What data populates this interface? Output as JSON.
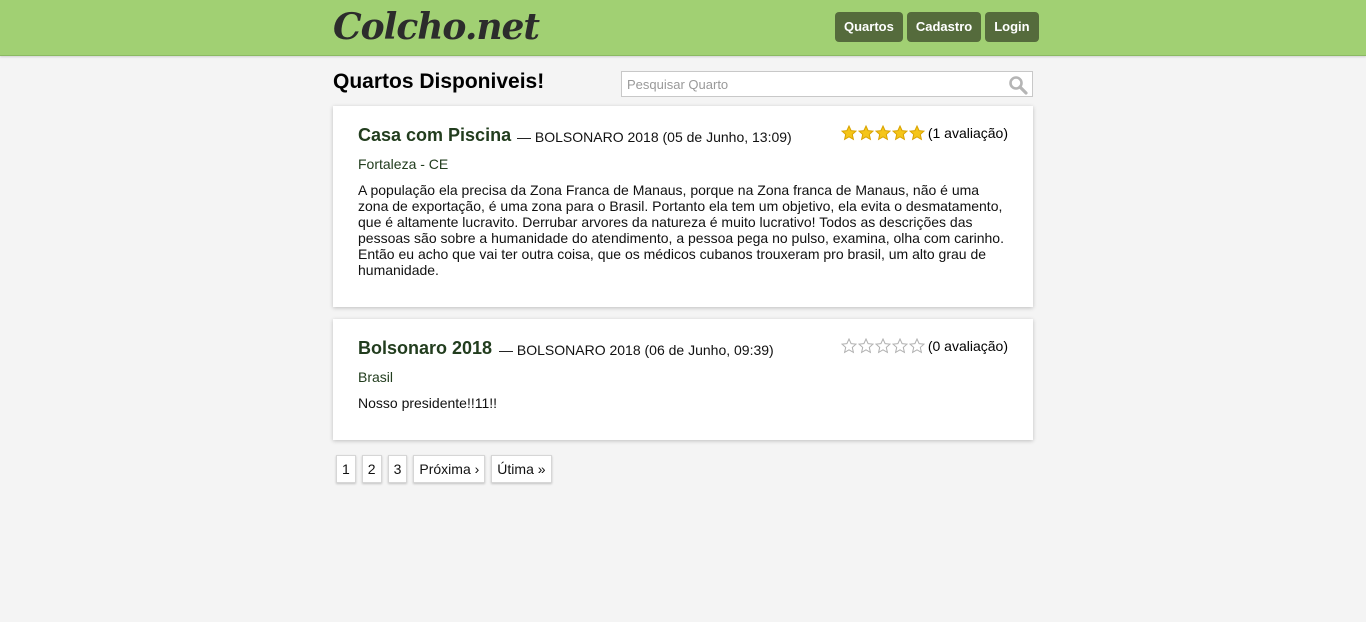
{
  "header": {
    "logo": "Colcho.net",
    "nav": [
      "Quartos",
      "Cadastro",
      "Login"
    ]
  },
  "page": {
    "title": "Quartos Disponiveis!"
  },
  "search": {
    "placeholder": "Pesquisar Quarto",
    "value": ""
  },
  "rooms": [
    {
      "title": "Casa com Piscina",
      "meta": "— BOLSONARO 2018 (05 de Junho, 13:09)",
      "location": "Fortaleza - CE",
      "rating": 5,
      "rating_label": "(1 avaliação)",
      "description": "A população ela precisa da Zona Franca de Manaus, porque na Zona franca de Manaus, não é uma zona de exportação, é uma zona para o Brasil. Portanto ela tem um objetivo, ela evita o desmatamento, que é altamente lucravito. Derrubar arvores da natureza é muito lucrativo! Todos as descrições das pessoas são sobre a humanidade do atendimento, a pessoa pega no pulso, examina, olha com carinho. Então eu acho que vai ter outra coisa, que os médicos cubanos trouxeram pro brasil, um alto grau de humanidade."
    },
    {
      "title": "Bolsonaro 2018",
      "meta": "— BOLSONARO 2018 (06 de Junho, 09:39)",
      "location": "Brasil",
      "rating": 0,
      "rating_label": "(0 avaliação)",
      "description": "Nosso presidente!!11!!"
    }
  ],
  "pagination": [
    "1",
    "2",
    "3",
    "Próxima ›",
    "Útima »"
  ],
  "colors": {
    "header": "#a1d073",
    "button": "#556b3c",
    "title": "#223d1e",
    "star_filled": "#f5c518"
  }
}
